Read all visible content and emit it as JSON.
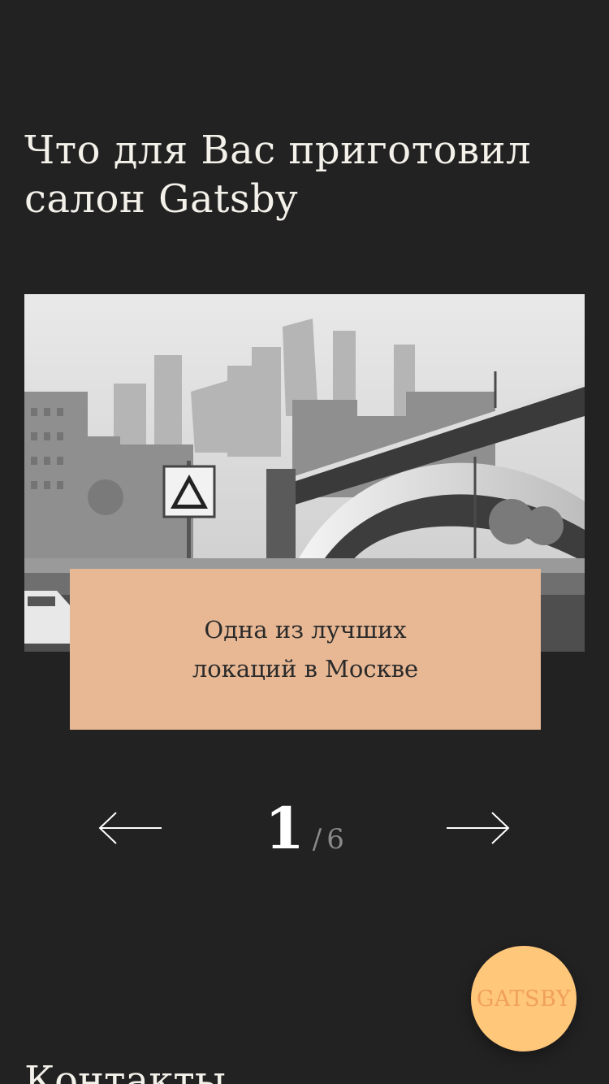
{
  "section": {
    "title": "Что для Вас приготовил салон Gatsby"
  },
  "slider": {
    "caption": "Одна из лучших\nлокаций в Москве",
    "current": "1",
    "separator": "/",
    "total": "6",
    "prev_icon": "arrow-left-icon",
    "next_icon": "arrow-right-icon"
  },
  "fab": {
    "label": "GATSBY"
  },
  "contacts": {
    "title": "Контакты"
  },
  "colors": {
    "background": "#222222",
    "caption_card": "#e8b894",
    "fab": "#ffc77a",
    "fab_text": "#f0a05a"
  }
}
